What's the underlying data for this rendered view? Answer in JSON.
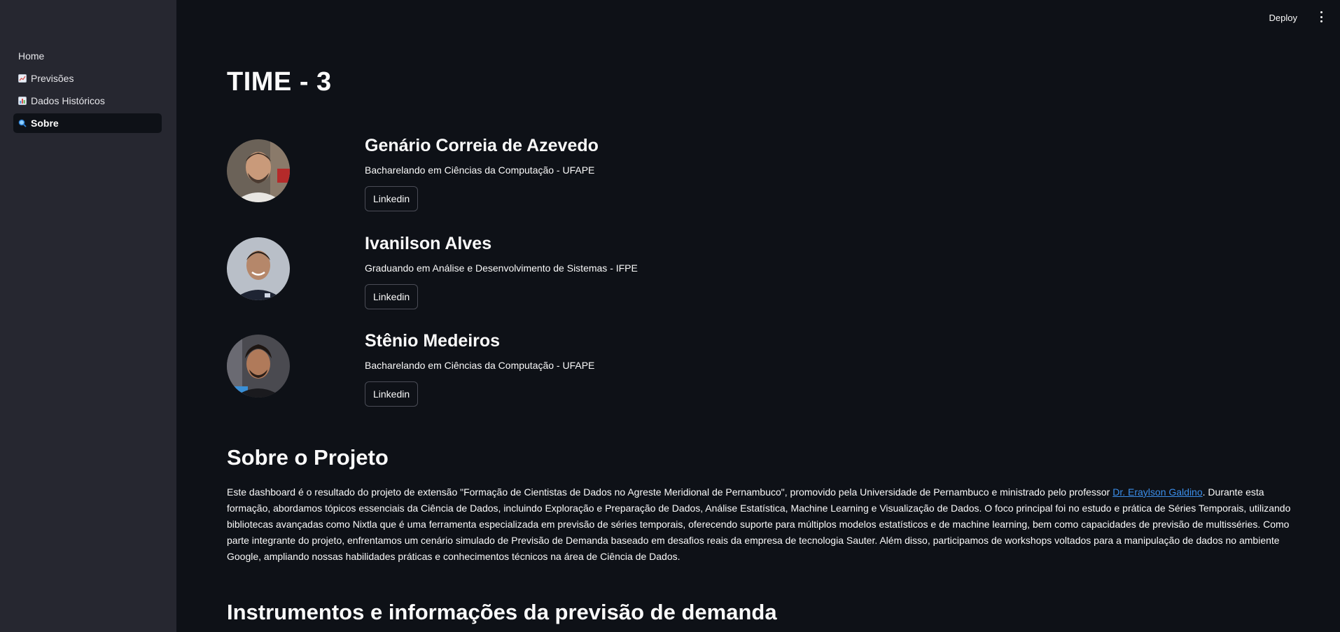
{
  "sidebar": {
    "items": [
      {
        "label": "Home",
        "icon": ""
      },
      {
        "label": "Previsões",
        "icon": "line-chart-icon"
      },
      {
        "label": "Dados Históricos",
        "icon": "bar-chart-icon"
      },
      {
        "label": "Sobre",
        "icon": "magnifier-icon"
      }
    ],
    "active_index": 3
  },
  "header": {
    "deploy_label": "Deploy",
    "menu_icon": "kebab-menu-icon"
  },
  "page": {
    "title": "TIME - 3"
  },
  "members": [
    {
      "name": "Genário Correia de Azevedo",
      "desc": "Bacharelando em Ciências da Computação - UFAPE",
      "button": "Linkedin"
    },
    {
      "name": "Ivanilson Alves",
      "desc": "Graduando em Análise e Desenvolvimento de Sistemas - IFPE",
      "button": "Linkedin"
    },
    {
      "name": "Stênio Medeiros",
      "desc": "Bacharelando em Ciências da Computação - UFAPE",
      "button": "Linkedin"
    }
  ],
  "about": {
    "heading": "Sobre o Projeto",
    "text_before_link": "Este dashboard é o resultado do projeto de extensão \"Formação de Cientistas de Dados no Agreste Meridional de Pernambuco\", promovido pela Universidade de Pernambuco e ministrado pelo professor ",
    "link_text": "Dr. Eraylson Galdino",
    "text_after_link": ". Durante esta formação, abordamos tópicos essenciais da Ciência de Dados, incluindo Exploração e Preparação de Dados, Análise Estatística, Machine Learning e Visualização de Dados. O foco principal foi no estudo e prática de Séries Temporais, utilizando bibliotecas avançadas como Nixtla que é uma ferramenta especializada em previsão de séries temporais, oferecendo suporte para múltiplos modelos estatísticos e de machine learning, bem como capacidades de previsão de multisséries. Como parte integrante do projeto, enfrentamos um cenário simulado de Previsão de Demanda baseado em desafios reais da empresa de tecnologia Sauter. Além disso, participamos de workshops voltados para a manipulação de dados no ambiente Google, ampliando nossas habilidades práticas e conhecimentos técnicos na área de Ciência de Dados."
  },
  "instruments": {
    "heading": "Instrumentos e informações da previsão de demanda"
  },
  "colors": {
    "background": "#0e1117",
    "sidebar": "#262730",
    "text": "#fafafa",
    "link": "#3b8eea",
    "button_border": "#4a4c56"
  }
}
